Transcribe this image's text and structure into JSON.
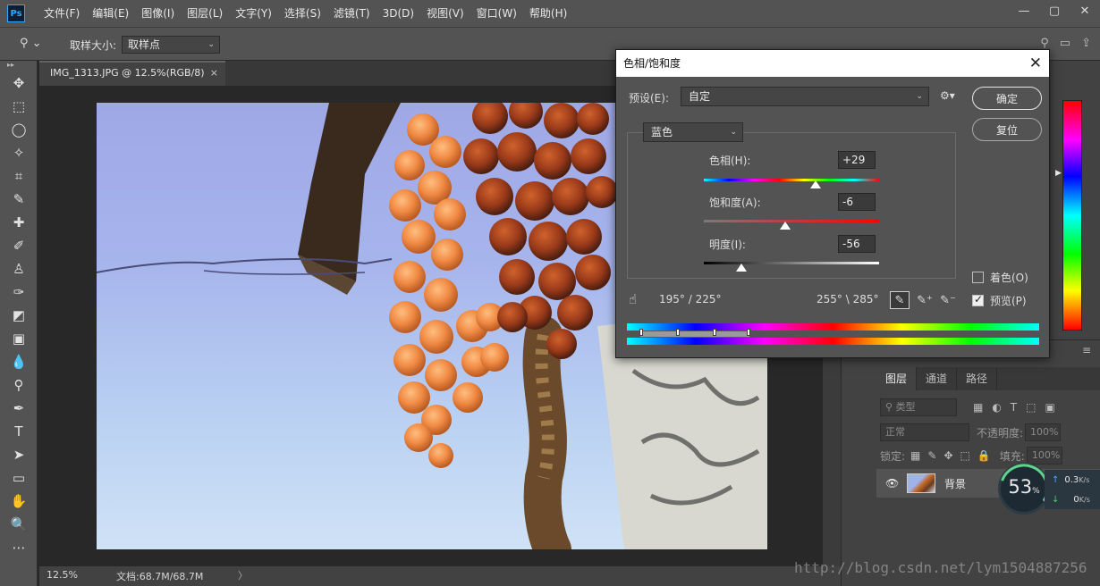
{
  "app": {
    "logo_text": "Ps"
  },
  "menu": [
    "文件(F)",
    "编辑(E)",
    "图像(I)",
    "图层(L)",
    "文字(Y)",
    "选择(S)",
    "滤镜(T)",
    "3D(D)",
    "视图(V)",
    "窗口(W)",
    "帮助(H)"
  ],
  "window_controls": {
    "minimize": "—",
    "maximize": "▢",
    "close": "✕"
  },
  "options_bar": {
    "sample_size_label": "取样大小:",
    "sample_size_value": "取样点"
  },
  "document": {
    "tab_title": "IMG_1313.JPG @ 12.5%(RGB/8)",
    "close": "×"
  },
  "status": {
    "zoom": "12.5%",
    "doc_info": "文档:68.7M/68.7M",
    "arrow": "〉"
  },
  "dialog": {
    "title": "色相/饱和度",
    "preset_label": "预设(E):",
    "preset_value": "自定",
    "ok_label": "确定",
    "reset_label": "复位",
    "channel_value": "蓝色",
    "hue_label": "色相(H):",
    "hue_value": "+29",
    "saturation_label": "饱和度(A):",
    "saturation_value": "-6",
    "lightness_label": "明度(I):",
    "lightness_value": "-56",
    "colorize_label": "着色(O)",
    "colorize_checked": false,
    "preview_label": "预览(P)",
    "preview_checked": true,
    "range_left": "195° / 225°",
    "range_right": "255° \\ 285°"
  },
  "layers": {
    "tabs": [
      "图层",
      "通道",
      "路径"
    ],
    "kind_filter": "类型",
    "blend_mode": "正常",
    "opacity_label": "不透明度:",
    "opacity_value": "100%",
    "lock_label": "锁定:",
    "fill_label": "填充:",
    "fill_value": "100%",
    "layer_name": "背景"
  },
  "speed_widget": {
    "value": "53",
    "unit": "%",
    "up": "0.3",
    "down": "0",
    "rate_unit": "K/s"
  },
  "watermark": "http://blog.csdn.net/lym1504887256",
  "colors": {
    "accent_blue": "#31a8ff",
    "panel_bg": "#424242",
    "dialog_bg": "#535353"
  }
}
